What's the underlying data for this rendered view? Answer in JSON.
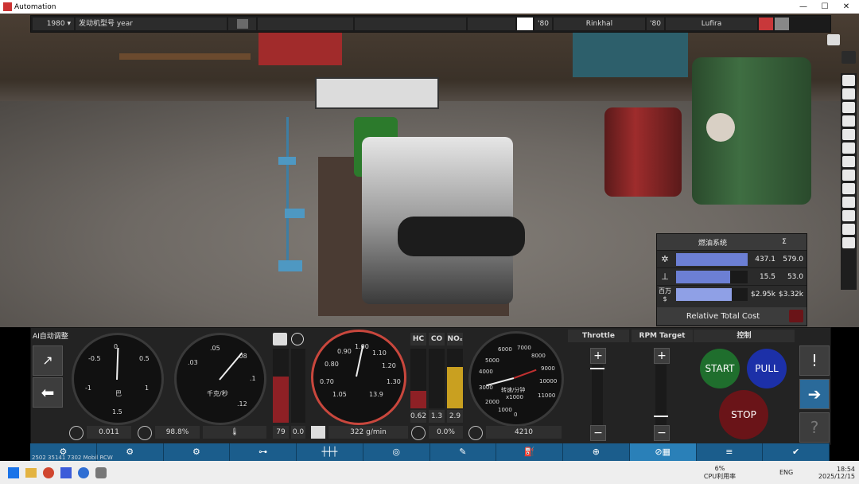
{
  "window": {
    "title": "Automation",
    "minimize": "—",
    "maximize": "☐",
    "close": "✕"
  },
  "topbar": {
    "year": "1980",
    "year_arrow": "▾",
    "engine_name_label": "发动机型号 year",
    "year1": "'80",
    "car1": "Rinkhal",
    "year2": "'80",
    "car2": "Lufira"
  },
  "cost_panel": {
    "title": "燃油系统",
    "sigma": "Σ",
    "rows": [
      {
        "icon": "gear-icon",
        "value": "437.1",
        "total": "579.0",
        "fill": 1.0
      },
      {
        "icon": "anvil-icon",
        "value": "15.5",
        "total": "53.0",
        "fill": 0.76
      },
      {
        "label": "百万$",
        "value": "$2.95k",
        "total": "$3.32k",
        "fill": 0.78
      }
    ],
    "footer": "Relative Total Cost"
  },
  "dashboard": {
    "ai_label": "AI自动调整",
    "gauge1": {
      "ticks": [
        "-0.5",
        "0",
        "0.5",
        "-1",
        "1",
        "-1.5",
        "1.5"
      ],
      "unit": "巴",
      "readout": "0.011"
    },
    "gauge2": {
      "ticks": [
        ".05",
        ".03",
        ".08",
        ".1",
        ".12"
      ],
      "unit": "千克/秒",
      "readout": "98.8%"
    },
    "temp": {
      "readout1": "79",
      "readout2": "0.0",
      "fill": 0.62
    },
    "gauge3": {
      "ticks": [
        "0.90",
        "1.00",
        "1.10",
        "0.80",
        "1.20",
        "0.70",
        "1.30"
      ],
      "readout_left": "1.05",
      "readout_right": "13.9",
      "bottom": "322 g/min"
    },
    "emissions": {
      "labels": [
        "HC",
        "CO",
        "NOₓ"
      ],
      "values": [
        "0.62",
        "1.3",
        "2.9"
      ],
      "fills": [
        0.3,
        0.0,
        0.7
      ],
      "bottom": "0.0%"
    },
    "gauge4": {
      "ticks": [
        "6000",
        "7000",
        "5000",
        "8000",
        "4000",
        "9000",
        "3000",
        "10000",
        "2000",
        "11000",
        "1000",
        "0"
      ],
      "unit": "转速/分钟",
      "unit2": "x1000",
      "readout": "4210"
    },
    "throttle": {
      "title": "Throttle",
      "plus": "+",
      "minus": "−"
    },
    "rpm_target": {
      "title": "RPM Target",
      "plus": "+",
      "minus": "−"
    },
    "control": {
      "title": "控制",
      "start": "START",
      "pull": "PULL",
      "stop": "STOP"
    },
    "side_buttons": {
      "alert": "!",
      "arrow": "➔",
      "help": "?"
    }
  },
  "bottom_tabs": [
    "⚙",
    "⚙",
    "⚙",
    "⊶",
    "┼┼┼",
    "◎",
    "✎",
    "⛽",
    "⊕",
    "⊘▦",
    "≡",
    "✔"
  ],
  "active_tab": 9,
  "watermark": "2502 35141 7302 Mobil RCW",
  "taskbar": {
    "cpu_percent": "6%",
    "cpu_label": "CPU利用率",
    "lang": "ENG",
    "time": "18:54",
    "date": "2025/12/15"
  },
  "colors": {
    "start": "#1f6e2d",
    "pull": "#1c30a8",
    "stop": "#6a1418",
    "accent_tab": "#2a80b8",
    "cost_bar": "#6c7fd4"
  }
}
